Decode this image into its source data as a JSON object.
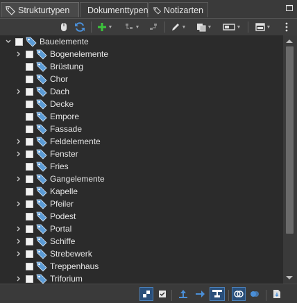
{
  "tabs": [
    {
      "label": "Strukturtypen",
      "active": true
    },
    {
      "label": "Dokumenttypen",
      "active": false
    },
    {
      "label": "Notizarten",
      "active": false
    }
  ],
  "toolbar": {
    "icons": [
      "sync-status-icon",
      "refresh-icon",
      "add-icon",
      "move-down-icon",
      "move-up-icon",
      "edit-icon",
      "copy-icon",
      "view-mode-icon",
      "dock-window-icon",
      "more-menu-icon"
    ]
  },
  "tree": {
    "root": {
      "label": "Bauelemente",
      "expanded": true
    },
    "items": [
      {
        "label": "Bogenelemente",
        "expandable": true
      },
      {
        "label": "Brüstung",
        "expandable": false
      },
      {
        "label": "Chor",
        "expandable": false
      },
      {
        "label": "Dach",
        "expandable": true
      },
      {
        "label": "Decke",
        "expandable": false
      },
      {
        "label": "Empore",
        "expandable": false
      },
      {
        "label": "Fassade",
        "expandable": false
      },
      {
        "label": "Feldelemente",
        "expandable": true
      },
      {
        "label": "Fenster",
        "expandable": true
      },
      {
        "label": "Fries",
        "expandable": false
      },
      {
        "label": "Gangelemente",
        "expandable": true
      },
      {
        "label": "Kapelle",
        "expandable": false
      },
      {
        "label": "Pfeiler",
        "expandable": true
      },
      {
        "label": "Podest",
        "expandable": false
      },
      {
        "label": "Portal",
        "expandable": true
      },
      {
        "label": "Schiffe",
        "expandable": true
      },
      {
        "label": "Strebewerk",
        "expandable": true
      },
      {
        "label": "Treppenhaus",
        "expandable": false
      },
      {
        "label": "Triforium",
        "expandable": true
      }
    ]
  },
  "colors": {
    "accent_blue": "#4a8fd8",
    "tag_blue": "#5b9bd5",
    "add_green": "#3cc43c"
  }
}
